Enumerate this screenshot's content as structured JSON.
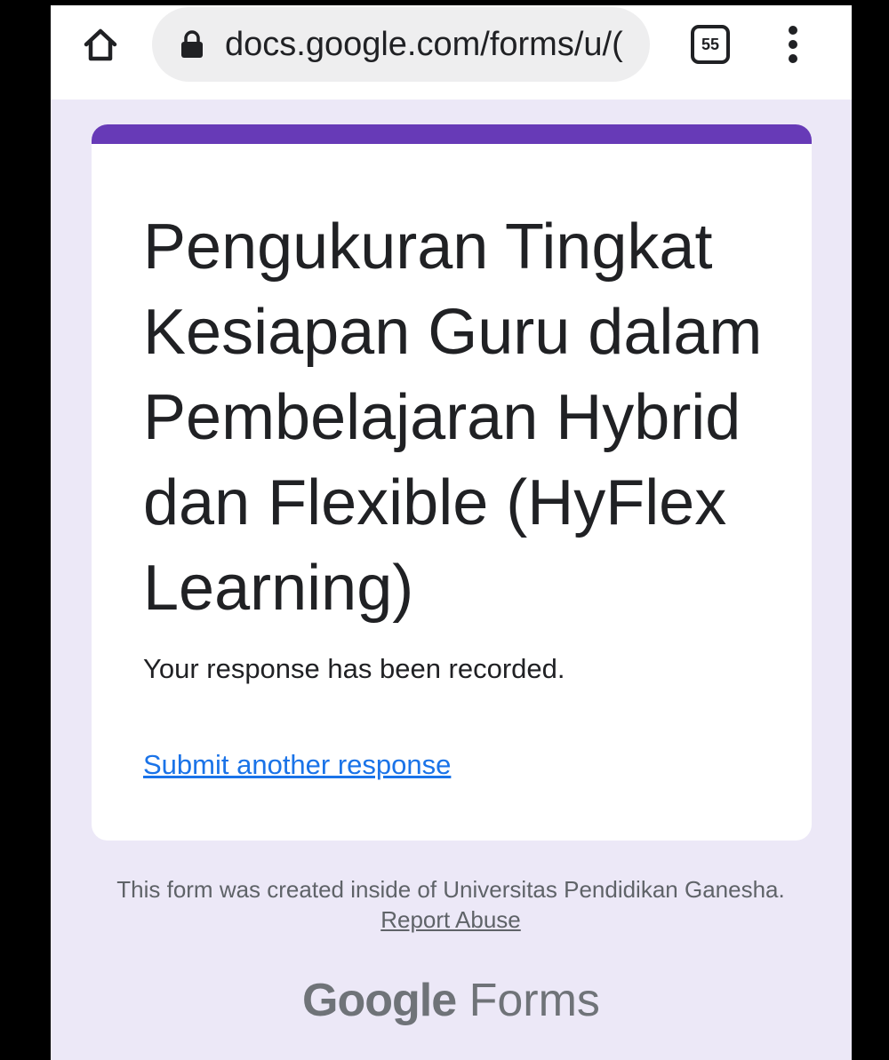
{
  "browser": {
    "url": "docs.google.com/forms/u/(",
    "tab_count": "55",
    "icons": {
      "home": "home-icon",
      "lock": "lock-icon",
      "tabs": "tab-switcher-icon",
      "menu": "more-vert-icon"
    }
  },
  "form": {
    "title": "Pengukuran Tingkat Kesiapan Guru dalam Pembelajaran Hybrid dan Flexible (HyFlex Learning)",
    "confirmation": "Your response has been recorded.",
    "submit_another_label": "Submit another response",
    "accent_color": "#673ab7"
  },
  "footer": {
    "note_prefix": "This form was created inside of Universitas Pendidikan Ganesha.",
    "report_abuse_label": "Report Abuse",
    "brand_google": "Google",
    "brand_forms": "Forms"
  }
}
